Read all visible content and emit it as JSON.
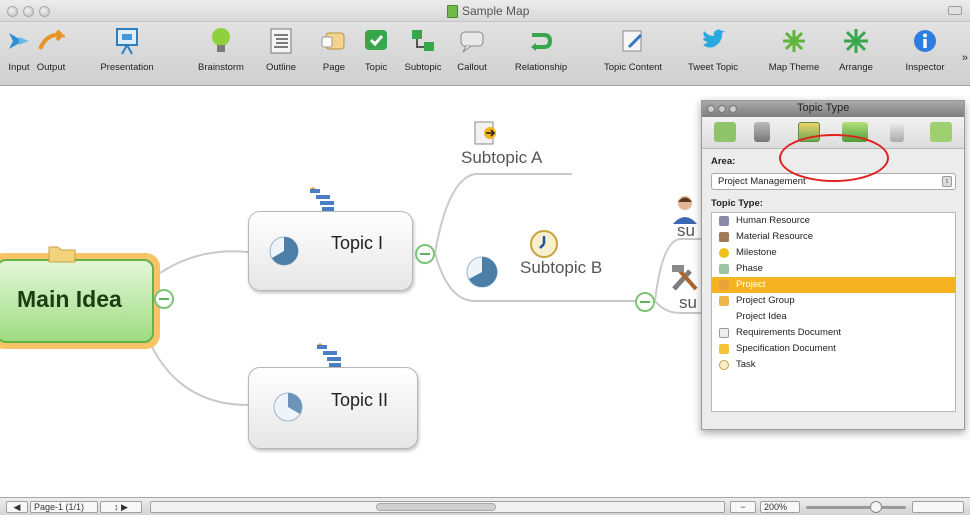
{
  "window": {
    "title": "Sample Map"
  },
  "toolbar": {
    "items": [
      {
        "label": "Input",
        "icon": "input-arrow-icon"
      },
      {
        "label": "Output",
        "icon": "output-arrow-icon"
      },
      {
        "label": "Presentation",
        "icon": "presentation-icon"
      },
      {
        "label": "Brainstorm",
        "icon": "lightbulb-icon"
      },
      {
        "label": "Outline",
        "icon": "outline-icon"
      },
      {
        "label": "Page",
        "icon": "page-icon"
      },
      {
        "label": "Topic",
        "icon": "topic-icon"
      },
      {
        "label": "Subtopic",
        "icon": "subtopic-icon"
      },
      {
        "label": "Callout",
        "icon": "callout-icon"
      },
      {
        "label": "Relationship",
        "icon": "relationship-icon"
      },
      {
        "label": "Topic Content",
        "icon": "topic-content-icon"
      },
      {
        "label": "Tweet Topic",
        "icon": "twitter-bird-icon"
      },
      {
        "label": "Map Theme",
        "icon": "map-theme-icon"
      },
      {
        "label": "Arrange",
        "icon": "arrange-icon"
      },
      {
        "label": "Inspector",
        "icon": "info-icon"
      }
    ],
    "overflow": "»"
  },
  "map": {
    "main_idea": "Main Idea",
    "topic1": "Topic I",
    "topic2": "Topic II",
    "subtopic_a": "Subtopic A",
    "subtopic_b": "Subtopic B",
    "sub_partial_1": "su",
    "sub_partial_2": "su"
  },
  "inspector": {
    "title": "Topic Type",
    "area_label": "Area:",
    "area_value": "Project Management",
    "topic_type_label": "Topic Type:",
    "types": [
      {
        "label": "Human Resource",
        "icon": "person-icon",
        "selected": false
      },
      {
        "label": "Material Resource",
        "icon": "tools-icon",
        "selected": false
      },
      {
        "label": "Milestone",
        "icon": "milestone-icon",
        "selected": false
      },
      {
        "label": "Phase",
        "icon": "phase-icon",
        "selected": false
      },
      {
        "label": "Project",
        "icon": "project-icon",
        "selected": true
      },
      {
        "label": "Project Group",
        "icon": "project-group-icon",
        "selected": false
      },
      {
        "label": "Project Idea",
        "icon": "",
        "selected": false
      },
      {
        "label": "Requirements Document",
        "icon": "requirements-doc-icon",
        "selected": false
      },
      {
        "label": "Specification Document",
        "icon": "specification-doc-icon",
        "selected": false
      },
      {
        "label": "Task",
        "icon": "task-clock-icon",
        "selected": false
      }
    ]
  },
  "statusbar": {
    "page": "Page-1 (1/1)",
    "zoom": "200%"
  }
}
